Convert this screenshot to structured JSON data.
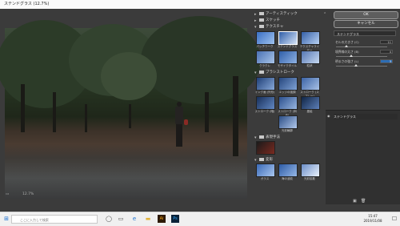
{
  "window": {
    "title": "ステンドグラス (12.7%)"
  },
  "preview": {
    "zoom_text": "12.7%"
  },
  "gallery": {
    "categories": [
      {
        "label": "アーティスティック"
      },
      {
        "label": "スケッチ"
      },
      {
        "label": "テクスチャ"
      },
      {
        "label": "ブラシストローク"
      },
      {
        "label": "表現手法"
      },
      {
        "label": "変形"
      }
    ],
    "thumbs": [
      [
        "パッチワーク",
        "ステンドグラス",
        "テクスチャライザー"
      ],
      [
        "クラクレ",
        "モザイクタイル",
        "粒状"
      ],
      [
        "インク画 (外形)",
        "エッジの強調",
        "ストローク (スプレー)"
      ],
      [
        "ストローク (暗)",
        "ストローク (斜め)",
        "墨絵"
      ],
      [
        "光彩輪郭"
      ],
      [
        "ガラス",
        "海の波紋",
        "光彩拡散"
      ]
    ]
  },
  "right": {
    "ok": "OK",
    "cancel": "キャンセル",
    "filter": "ステンドグラス",
    "params": [
      {
        "label": "セルの大きさ (C)",
        "value": "11"
      },
      {
        "label": "境界線の太さ (B)",
        "value": "4"
      },
      {
        "label": "明るさの強さ (L)",
        "value": "3"
      }
    ],
    "layer": "ステンドグラス"
  },
  "taskbar": {
    "search_placeholder": "ここに入力して検索",
    "time": "15:47",
    "date": "2019/11/08"
  },
  "colors": {
    "accent": "#2d6db5",
    "bg": "#3b3b3b"
  }
}
